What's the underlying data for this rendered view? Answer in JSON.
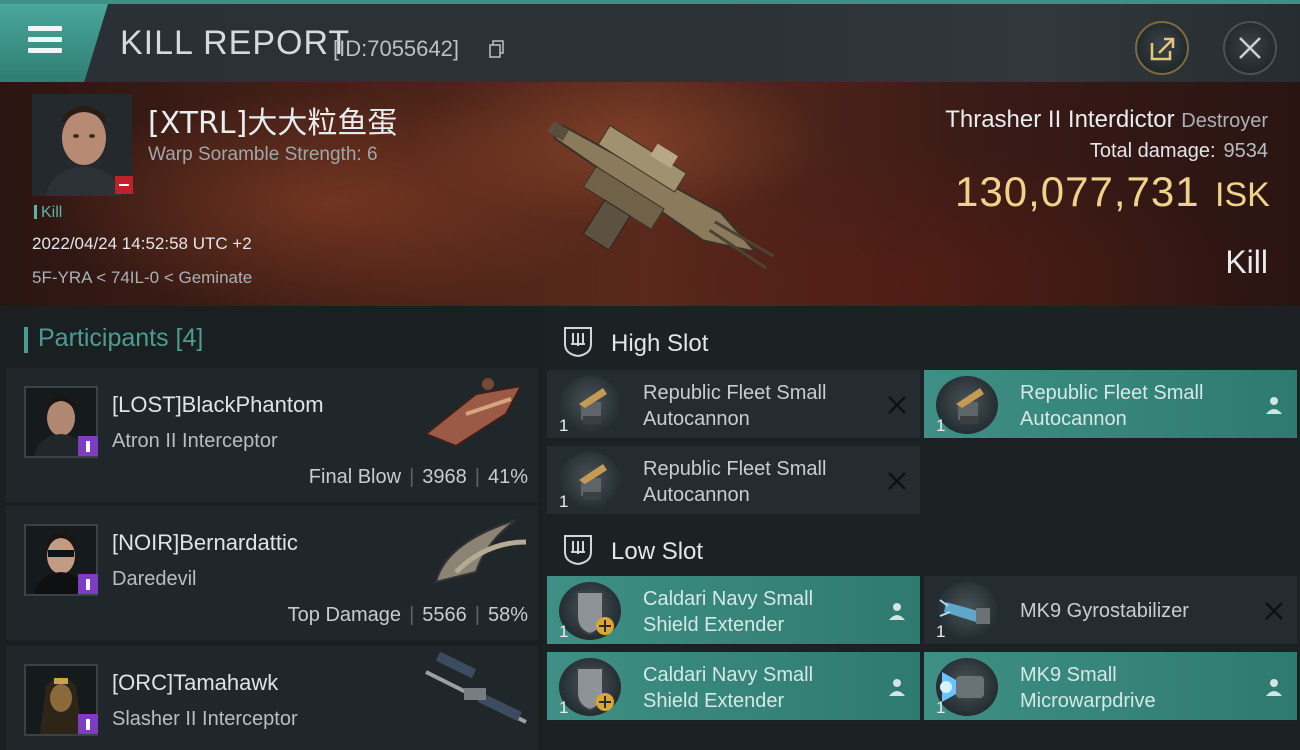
{
  "header": {
    "title": "KILL REPORT",
    "report_id": "[ID:7055642]",
    "icons": {
      "menu": "hamburger-menu-icon",
      "copy": "copy-icon",
      "share": "share-icon",
      "close": "close-icon"
    }
  },
  "victim": {
    "name": "[XTRL]大大粒鱼蛋",
    "subtitle": "Warp Soramble Strength: 6",
    "tag": "Kill",
    "datetime": "2022/04/24 14:52:58 UTC +2",
    "location": "5F-YRA < 74IL-0 < Geminate",
    "ship_name": "Thrasher II Interdictor",
    "ship_class": "Destroyer",
    "total_damage_label": "Total damage:",
    "total_damage": "9534",
    "isk_value": "130,077,731",
    "isk_unit": "ISK",
    "result": "Kill"
  },
  "participants": {
    "header": "Participants [4]",
    "items": [
      {
        "name": "[LOST]BlackPhantom",
        "ship": "Atron II Interceptor",
        "role": "Final Blow",
        "damage": "3968",
        "percent": "41%"
      },
      {
        "name": "[NOIR]Bernardattic",
        "ship": "Daredevil",
        "role": "Top Damage",
        "damage": "5566",
        "percent": "58%"
      },
      {
        "name": "[ORC]Tamahawk",
        "ship": "Slasher II Interceptor",
        "role": "",
        "damage": "",
        "percent": ""
      }
    ]
  },
  "slots": {
    "high": {
      "label": "High Slot",
      "modules": [
        {
          "line1": "Republic Fleet Small",
          "line2": "Autocannon",
          "qty": "1",
          "state": "destroyed",
          "highlight": false
        },
        {
          "line1": "Republic Fleet Small",
          "line2": "Autocannon",
          "qty": "1",
          "state": "dropped",
          "highlight": true
        },
        {
          "line1": "Republic Fleet Small",
          "line2": "Autocannon",
          "qty": "1",
          "state": "destroyed",
          "highlight": false
        }
      ]
    },
    "low": {
      "label": "Low Slot",
      "modules": [
        {
          "line1": "Caldari Navy Small",
          "line2": "Shield Extender",
          "qty": "1",
          "state": "dropped",
          "highlight": true
        },
        {
          "line1": "MK9 Gyrostabilizer",
          "line2": "",
          "qty": "1",
          "state": "destroyed",
          "highlight": false
        },
        {
          "line1": "Caldari Navy Small",
          "line2": "Shield Extender",
          "qty": "1",
          "state": "dropped",
          "highlight": true
        },
        {
          "line1": "MK9 Small",
          "line2": "Microwarpdrive",
          "qty": "1",
          "state": "dropped",
          "highlight": true
        }
      ]
    }
  },
  "colors": {
    "accent": "#3e8f85",
    "isk": "#f0d38a",
    "badge": "#7c3cc4",
    "minus": "#c0202a"
  }
}
